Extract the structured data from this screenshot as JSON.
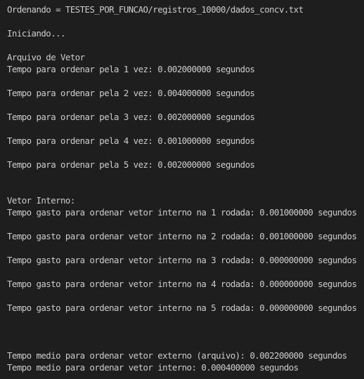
{
  "terminal": {
    "header": {
      "ordering_file": "Ordenando = TESTES_POR_FUNCAO/registros_10000/dados_concv.txt",
      "starting": "Iniciando..."
    },
    "vector_file": {
      "title": "Arquivo de Vetor",
      "runs": [
        "Tempo para ordenar pela 1 vez: 0.002000000 segundos",
        "Tempo para ordenar pela 2 vez: 0.004000000 segundos",
        "Tempo para ordenar pela 3 vez: 0.002000000 segundos",
        "Tempo para ordenar pela 4 vez: 0.001000000 segundos",
        "Tempo para ordenar pela 5 vez: 0.002000000 segundos"
      ]
    },
    "internal_vector": {
      "title": "Vetor Interno:",
      "runs": [
        "Tempo gasto para ordenar vetor interno na 1 rodada: 0.001000000 segundos",
        "Tempo gasto para ordenar vetor interno na 2 rodada: 0.001000000 segundos",
        "Tempo gasto para ordenar vetor interno na 3 rodada: 0.000000000 segundos",
        "Tempo gasto para ordenar vetor interno na 4 rodada: 0.000000000 segundos",
        "Tempo gasto para ordenar vetor interno na 5 rodada: 0.000000000 segundos"
      ]
    },
    "summary": {
      "external_avg": "Tempo medio para ordenar vetor externo (arquivo): 0.002200000 segundos",
      "internal_avg": "Tempo medio para ordenar vetor interno: 0.000400000 segundos"
    }
  }
}
